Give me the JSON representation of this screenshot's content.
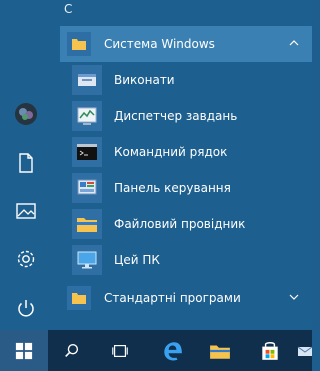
{
  "start_menu": {
    "section_letter": "С",
    "group": {
      "label": "Система Windows",
      "expanded": true
    },
    "items": [
      {
        "label": "Виконати",
        "icon": "run-icon"
      },
      {
        "label": "Диспетчер завдань",
        "icon": "task-manager-icon"
      },
      {
        "label": "Командний рядок",
        "icon": "command-prompt-icon"
      },
      {
        "label": "Панель керування",
        "icon": "control-panel-icon"
      },
      {
        "label": "Файловий провідник",
        "icon": "file-explorer-icon"
      },
      {
        "label": "Цей ПК",
        "icon": "this-pc-icon"
      }
    ],
    "next_group": {
      "label": "Стандартні програми",
      "expanded": false
    }
  },
  "rail_icons": [
    "avatar",
    "document-icon",
    "pictures-icon",
    "settings-icon",
    "power-icon"
  ],
  "taskbar": [
    "windows-start-icon",
    "search-icon",
    "task-view-icon",
    "edge-icon",
    "file-explorer-icon",
    "store-icon"
  ],
  "colors": {
    "menu_bg": "#1d5f8f",
    "group_highlight": "#3a80b3",
    "taskbar_bg": "#0f2f4d",
    "accent": "#2a5a86"
  }
}
